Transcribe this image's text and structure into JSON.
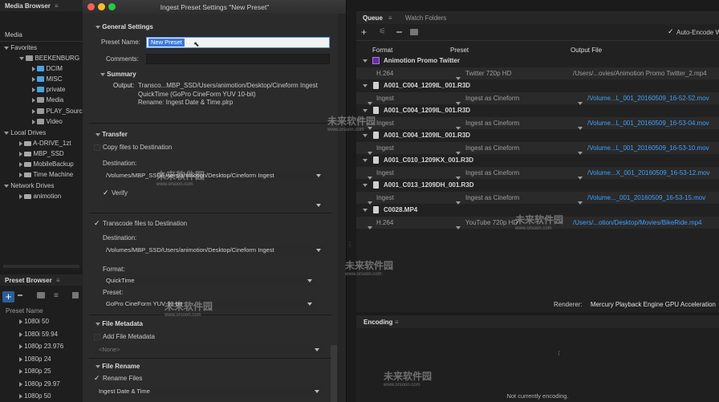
{
  "media_browser": {
    "title": "Media Browser",
    "menu_icon": "menu-icon",
    "media_label": "Media",
    "favorites_label": "Favorites",
    "favorites": [
      "BEEKENBURG",
      "DCIM",
      "MISC",
      "private",
      "Media",
      "PLAY_Source",
      "Video"
    ],
    "local_drives_label": "Local Drives",
    "local_drives": [
      "A-DRIVE_1zt",
      "MBP_SSD",
      "MobileBackup",
      "Time Machine"
    ],
    "network_drives_label": "Network Drives",
    "network_drives": [
      "animotion"
    ]
  },
  "preset_browser": {
    "title": "Preset Browser",
    "column": "Preset Name",
    "presets": [
      "1080i 50",
      "1080i 59.94",
      "1080p 23.976",
      "1080p 24",
      "1080p 25",
      "1080p 29.97",
      "1080p 50"
    ]
  },
  "dialog": {
    "title": "Ingest Preset Settings \"New Preset\"",
    "general_settings": "General Settings",
    "preset_name_label": "Preset Name:",
    "preset_name_value": "New Preset",
    "comments_label": "Comments:",
    "summary_label": "Summary",
    "output_label": "Output:",
    "output_lines": [
      "Transco...MBP_SSD/Users/animotion/Desktop/Cineform Ingest",
      "QuickTime (GoPro CineForm YUV 10-bit)",
      "Rename: Ingest Date & Time.plrp"
    ],
    "transfer_label": "Transfer",
    "copy_files": "Copy files to Destination",
    "destination_label": "Destination:",
    "destination_value": "/Volumes/MBP_SSD/Users/animotion/Desktop/Cineform Ingest",
    "verify": "Verify",
    "transcode_files": "Transcode files to Destination",
    "destination2_label": "Destination:",
    "destination2_value": "/Volumes/MBP_SSD/Users/animotion/Desktop/Cineform Ingest",
    "format_label": "Format:",
    "format_value": "QuickTime",
    "preset_label": "Preset:",
    "preset_value": "GoPro CineForm YUV 10-bit",
    "file_metadata_label": "File Metadata",
    "add_file_metadata": "Add File Metadata",
    "metadata_value": "<None>",
    "file_rename_label": "File Rename",
    "rename_files": "Rename Files",
    "rename_value": "Ingest Date & Time"
  },
  "queue": {
    "tab_queue": "Queue",
    "tab_watch": "Watch Folders",
    "auto_encode": "Auto-Encode W",
    "col_format": "Format",
    "col_preset": "Preset",
    "col_output": "Output File",
    "items": [
      {
        "source": "Animotion Promo Twitter",
        "format": "H.264",
        "preset": "Twitter 720p HD",
        "output": "/Users/...ovies/Animotion Promo Twitter_2.mp4",
        "output_blue": false,
        "type": "ame"
      },
      {
        "source": "A001_C004_1209IL_001.R3D",
        "format": "Ingest",
        "preset": "Ingest as Cineform",
        "output": "/Volume...L_001_20160509_16-52-52.mov",
        "output_blue": true,
        "type": "file"
      },
      {
        "source": "A001_C004_1209IL_001.R3D",
        "format": "Ingest",
        "preset": "Ingest as Cineform",
        "output": "/Volume...L_001_20160509_16-53-04.mov",
        "output_blue": true,
        "type": "file"
      },
      {
        "source": "A001_C004_1209IL_001.R3D",
        "format": "Ingest",
        "preset": "Ingest as Cineform",
        "output": "/Volume...L_001_20160509_16-53-10.mov",
        "output_blue": true,
        "type": "file"
      },
      {
        "source": "A001_C010_1209KX_001.R3D",
        "format": "Ingest",
        "preset": "Ingest as Cineform",
        "output": "/Volume...X_001_20160509_16-53-12.mov",
        "output_blue": true,
        "type": "file"
      },
      {
        "source": "A001_C013_1209DH_001.R3D",
        "format": "Ingest",
        "preset": "Ingest as Cineform",
        "output": "/Volume..._001_20160509_16-53-15.mov",
        "output_blue": true,
        "type": "file"
      },
      {
        "source": "C0028.MP4",
        "format": "H.264",
        "preset": "YouTube 720p HD",
        "output": "/Users/...otion/Desktop/Movies/BikeRide.mp4",
        "output_blue": true,
        "type": "file"
      }
    ],
    "renderer_label": "Renderer:",
    "renderer_value": "Mercury Playback Engine GPU Acceleration"
  },
  "encoding": {
    "title": "Encoding",
    "status": "Not currently encoding."
  },
  "watermarks": [
    "未来软件园",
    "www.orsoon.com"
  ]
}
